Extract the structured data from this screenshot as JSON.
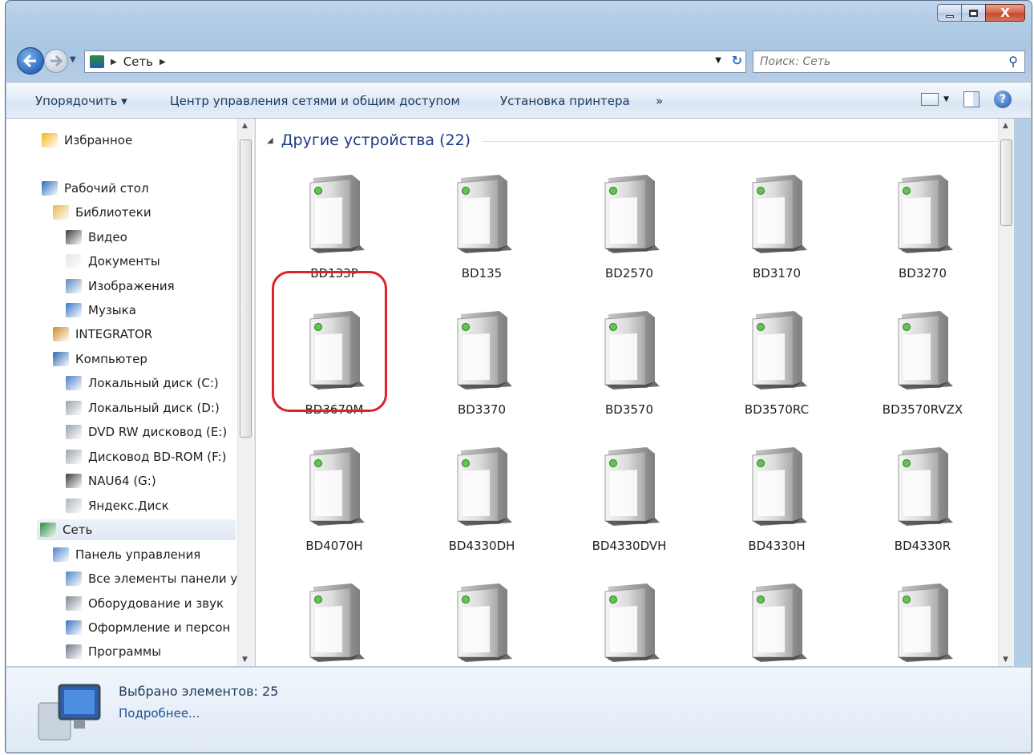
{
  "window": {
    "caption": {
      "minimize": "–",
      "maximize": "□",
      "close": "X"
    }
  },
  "address_bar": {
    "crumb": "Сеть"
  },
  "search": {
    "placeholder": "Поиск: Сеть"
  },
  "commands": [
    {
      "id": "organize",
      "label": "Упорядочить ▾"
    },
    {
      "id": "network_center",
      "label": "Центр управления сетями и общим доступом"
    },
    {
      "id": "add_printer",
      "label": "Установка принтера"
    },
    {
      "id": "more",
      "label": "»"
    }
  ],
  "nav_tree": [
    {
      "label": "Избранное",
      "icon": "star-icon",
      "color": "#f2b417"
    },
    {
      "label": "Рабочий стол",
      "icon": "desktop-icon",
      "color": "#2e6bbf"
    },
    {
      "label": "Библиотеки",
      "icon": "libraries-icon",
      "color": "#e7b64a"
    },
    {
      "label": "Видео",
      "icon": "video-icon",
      "color": "#3c3c3c"
    },
    {
      "label": "Документы",
      "icon": "documents-icon",
      "color": "#e6e6e6"
    },
    {
      "label": "Изображения",
      "icon": "pictures-icon",
      "color": "#5a88c0"
    },
    {
      "label": "Музыка",
      "icon": "music-icon",
      "color": "#3a74c9"
    },
    {
      "label": "INTEGRATOR",
      "icon": "user-icon",
      "color": "#d08a24"
    },
    {
      "label": "Компьютер",
      "icon": "computer-icon",
      "color": "#2d67b5"
    },
    {
      "label": "Локальный диск (C:)",
      "icon": "system-drive-icon",
      "color": "#4a7fc9"
    },
    {
      "label": "Локальный диск (D:)",
      "icon": "drive-icon",
      "color": "#9aa3ad"
    },
    {
      "label": "DVD RW дисковод (E:)",
      "icon": "dvd-drive-icon",
      "color": "#9aa3ad"
    },
    {
      "label": "Дисковод BD-ROM (F:)",
      "icon": "bd-drive-icon",
      "color": "#9aa3ad"
    },
    {
      "label": "NAU64 (G:)",
      "icon": "usb-drive-icon",
      "color": "#3d3d3d"
    },
    {
      "label": "Яндекс.Диск",
      "icon": "cloud-drive-icon",
      "color": "#a9b4c2"
    },
    {
      "label": "Сеть",
      "icon": "network-icon",
      "color": "#2e8d3b",
      "selected": true
    },
    {
      "label": "Панель управления",
      "icon": "control-panel-icon",
      "color": "#4b86c9"
    },
    {
      "label": "Все элементы панели у",
      "icon": "control-panel-items-icon",
      "color": "#4b86c9"
    },
    {
      "label": "Оборудование и звук",
      "icon": "hardware-sound-icon",
      "color": "#7b8794"
    },
    {
      "label": "Оформление и персон",
      "icon": "personalization-icon",
      "color": "#3a6fc2"
    },
    {
      "label": "Программы",
      "icon": "programs-icon",
      "color": "#6d7a88"
    }
  ],
  "group": {
    "title": "Другие устройства (22)"
  },
  "devices": [
    "BD133P",
    "BD135",
    "BD2570",
    "BD3170",
    "BD3270",
    "BD3670M",
    "BD3370",
    "BD3570",
    "BD3570RC",
    "BD3570RVZX",
    "BD4070H",
    "BD4330DH",
    "BD4330DVH",
    "BD4330H",
    "BD4330R",
    "",
    "",
    "",
    "",
    ""
  ],
  "highlighted_device": "BD3670M",
  "status": {
    "count": "Выбрано элементов: 25",
    "details_link": "Подробнее..."
  },
  "colors": {
    "accent": "#1e3b86",
    "highlight": "#e0202a",
    "led": "#5cc74a"
  }
}
